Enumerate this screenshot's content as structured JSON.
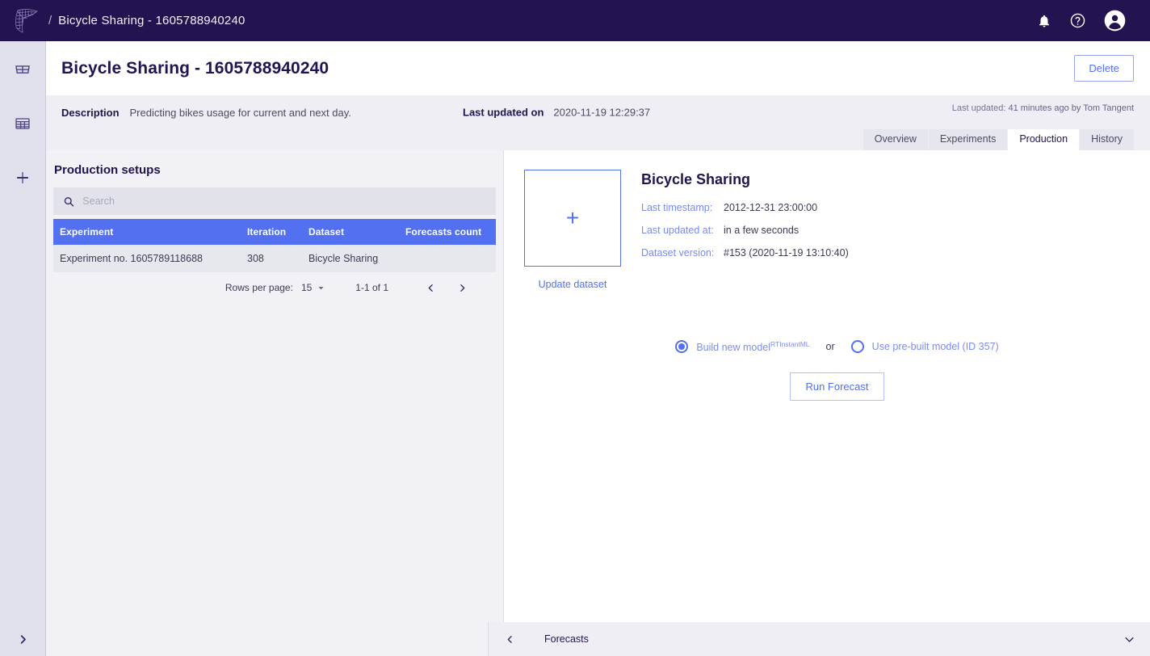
{
  "topbar": {
    "logo_name": "tangent-works-logo",
    "breadcrumb_separator": "/",
    "breadcrumb_title": "Bicycle Sharing - 1605788940240",
    "icons": [
      {
        "name": "notifications-bell-icon",
        "label": "Notifications"
      },
      {
        "name": "help-circle-icon",
        "label": "Help"
      },
      {
        "name": "user-avatar-icon",
        "label": "Account"
      }
    ]
  },
  "rail": {
    "items": [
      {
        "name": "dashboard-grid-icon",
        "label": "Dashboard"
      },
      {
        "name": "datasets-table-icon",
        "label": "Datasets"
      },
      {
        "name": "add-new-icon",
        "label": "Add new"
      }
    ],
    "expand_icon": "chevron-right-icon"
  },
  "page": {
    "title": "Bicycle Sharing - 1605788940240",
    "delete_label": "Delete"
  },
  "description_bar": {
    "description_label": "Description",
    "description_text": "Predicting bikes usage for current and next day.",
    "last_updated_on_label": "Last updated on",
    "last_updated_on_value": "2020-11-19 12:29:37",
    "last_updated_label": "Last updated:",
    "last_updated_value": "41 minutes ago by Tom Tangent"
  },
  "tabs": [
    {
      "label": "Overview",
      "active": false
    },
    {
      "label": "Experiments",
      "active": false
    },
    {
      "label": "Production",
      "active": true
    },
    {
      "label": "History",
      "active": false
    }
  ],
  "left_pane": {
    "heading": "Production setups",
    "search_placeholder": "Search",
    "search_value": "",
    "search_icon": "search-icon",
    "table": {
      "columns": [
        "Experiment",
        "Iteration",
        "Dataset",
        "Forecasts count"
      ],
      "rows": [
        {
          "experiment": "Experiment no. 1605789118688",
          "iteration": "308",
          "dataset": "Bicycle Sharing",
          "forecasts_count": ""
        }
      ]
    },
    "pagination": {
      "rows_per_page_label": "Rows per page:",
      "rows_per_page_value": "15",
      "range_label": "1-1 of 1",
      "prev_icon": "chevron-left-icon",
      "next_icon": "chevron-right-icon"
    }
  },
  "right_pane": {
    "dataset_card": {
      "plus_icon": "plus-icon",
      "update_label": "Update dataset"
    },
    "dataset_title": "Bicycle Sharing",
    "details": [
      {
        "key": "Last timestamp:",
        "value": "2012-12-31 23:00:00"
      },
      {
        "key": "Last updated at:",
        "value": "in a few seconds"
      },
      {
        "key": "Dataset version:",
        "value": "#153 (2020-11-19 13:10:40)"
      }
    ],
    "model_options": {
      "build_new_label": "Build new model",
      "build_new_sup": "RTInstantML",
      "build_new_selected": true,
      "or_label": "or",
      "prebuilt_label": "Use pre-built model (ID 357)",
      "prebuilt_selected": false
    },
    "run_forecast_label": "Run Forecast"
  },
  "bottom_bar": {
    "back_icon": "chevron-left-icon",
    "label": "Forecasts",
    "expand_icon": "chevron-down-icon"
  },
  "colors": {
    "brand_dark": "#231451",
    "accent_blue": "#5370f0",
    "table_header_blue": "#5370f0",
    "panel_gray": "#f1f1f6",
    "band_gray": "#eeeef4"
  }
}
